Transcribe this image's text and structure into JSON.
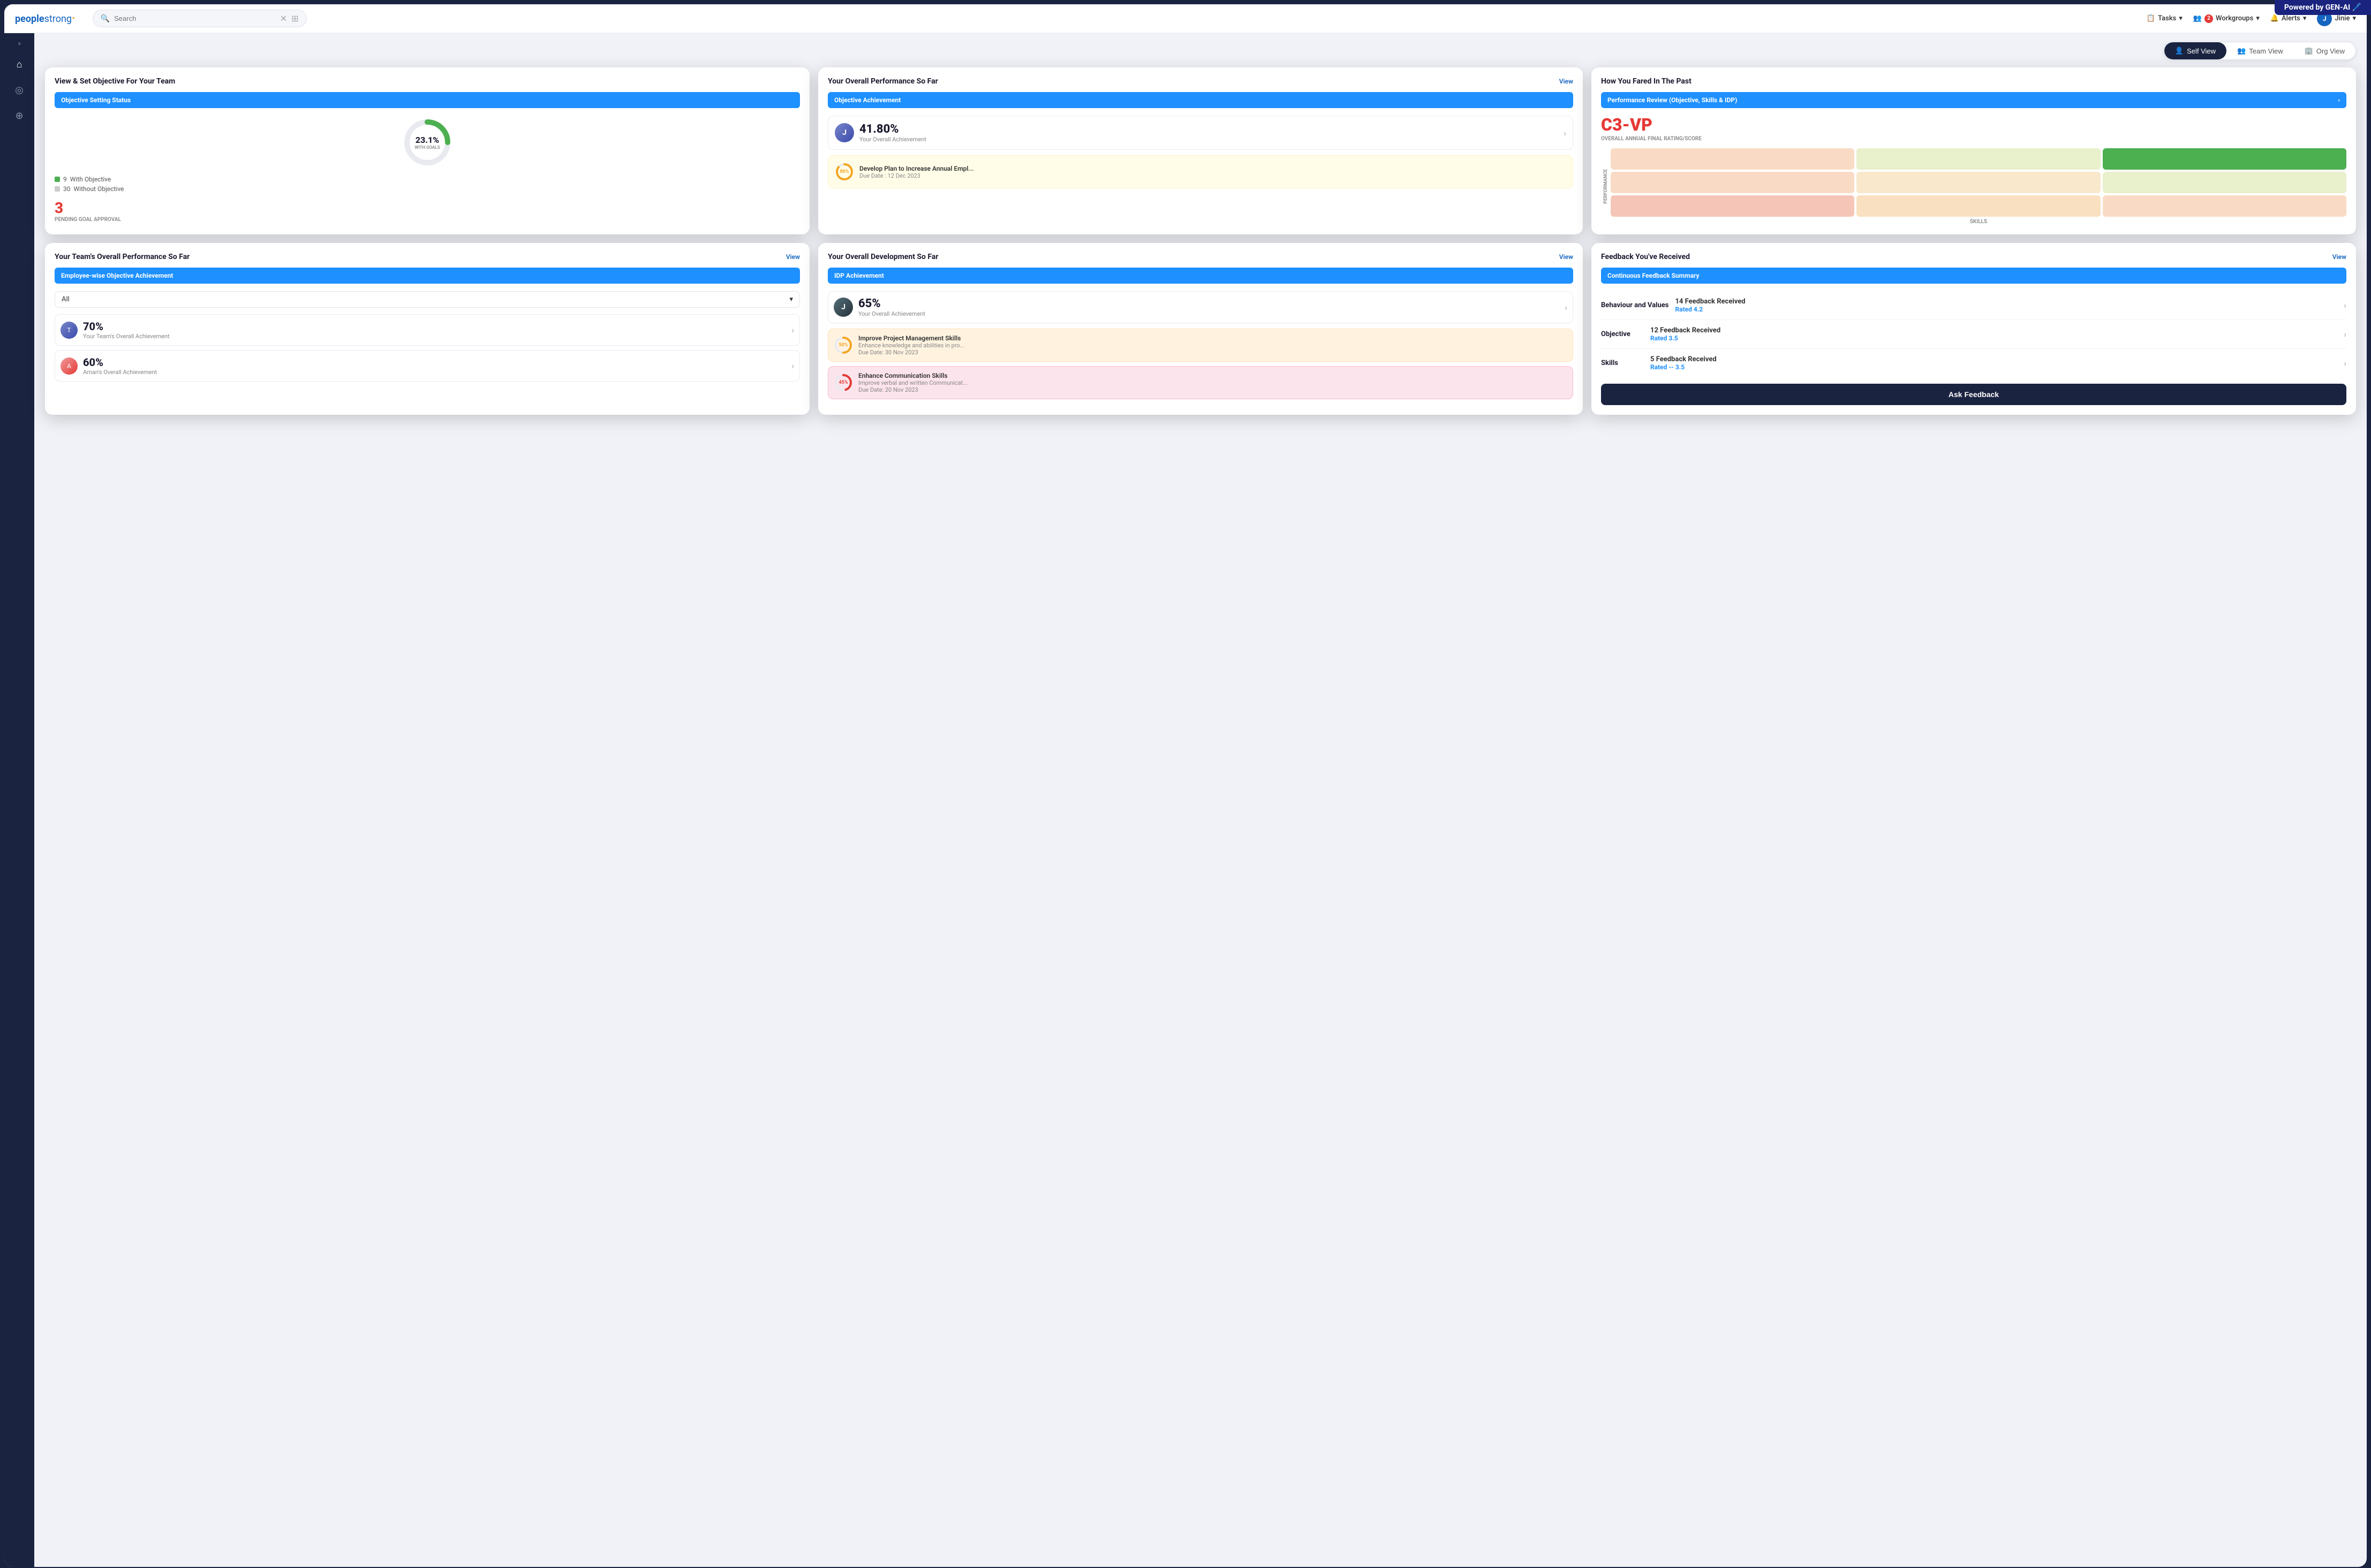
{
  "genai_banner": "Powered by GEN-AI 🖊️",
  "logo": {
    "text_regular": "people",
    "text_bold": "strong",
    "dot": "·"
  },
  "search": {
    "placeholder": "Search"
  },
  "nav": {
    "tasks_label": "Tasks",
    "workgroups_label": "Workgroups",
    "workgroups_badge": "2",
    "alerts_label": "Alerts",
    "user_label": "Jinie"
  },
  "view_toggle": {
    "self": "Self View",
    "team": "Team View",
    "org": "Org View"
  },
  "card1": {
    "title": "View & Set Objective For Your Team",
    "section_label": "Objective Setting Status",
    "donut_percent": "23.1%",
    "donut_sublabel": "WITH GOALS",
    "with_objective_count": "9",
    "with_objective_label": "With Objective",
    "without_objective_count": "30",
    "without_objective_label": "Without Objective",
    "pending_number": "3",
    "pending_label": "PENDING GOAL APPROVAL"
  },
  "card2": {
    "title": "Your Overall Performance So Far",
    "view_link": "View",
    "section_label": "Objective Achievement",
    "achievement_percent": "41.80%",
    "achievement_sub": "Your Overall Achievement",
    "goal_progress": "86%",
    "goal_title": "Develop Plan to Increase Annual Empl...",
    "goal_date": "Due Date : 12 Dec 2023"
  },
  "card3": {
    "title": "How You Fared In The Past",
    "review_label": "Performance Review (Objective, Skills & IDP)",
    "rating_score": "C3-VP",
    "rating_sub": "OVERALL ANNUAL FINAL RATING/SCORE",
    "matrix_label_v": "PERFORMANCE",
    "matrix_label_h": "SKILLS"
  },
  "card4": {
    "title": "Your Team's Overall Performance So Far",
    "view_link": "View",
    "section_label": "Employee-wise Objective Achievement",
    "filter_label": "All",
    "member1_percent": "70%",
    "member1_sub": "Your Team's Overall Achievement",
    "member2_percent": "60%",
    "member2_sub": "Aman's Overall Achievement"
  },
  "card5": {
    "title": "Your Overall Development So Far",
    "view_link": "View",
    "section_label": "IDP Achievement",
    "achievement_percent": "65%",
    "achievement_sub": "Your Overall Achievement",
    "skill1_progress": "50%",
    "skill1_title": "Improve Project Management Skills",
    "skill1_desc": "Enhance knowledge and abilities in pro...",
    "skill1_date": "Due Date: 30 Nov 2023",
    "skill2_progress": "45%",
    "skill2_title": "Enhance Communication Skills",
    "skill2_desc": "Improve verbal and written Communicat...",
    "skill2_date": "Due Date: 20 Nov 2023"
  },
  "card6": {
    "title": "Feedback You've Received",
    "view_link": "View",
    "section_label": "Continuous Feedback Summary",
    "row1_category": "Behaviour and Values",
    "row1_count": "14 Feedback Received",
    "row1_rating": "Rated",
    "row1_rating_value": "4.2",
    "row2_category": "Objective",
    "row2_count": "12 Feedback Received",
    "row2_rating": "Rated",
    "row2_rating_value": "3.5",
    "row3_category": "Skills",
    "row3_count": "5 Feedback Received",
    "row3_rating": "Rated --",
    "row3_rating_value": "3.5",
    "ask_btn": "Ask Feedback"
  }
}
